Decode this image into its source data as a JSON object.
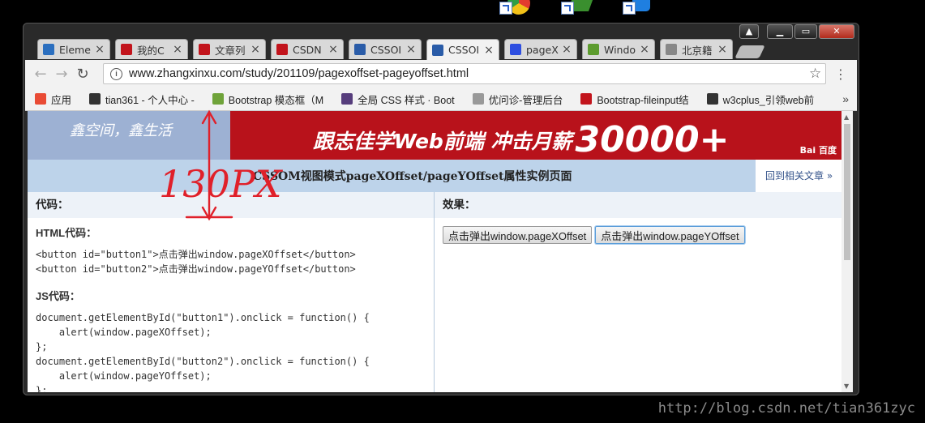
{
  "window": {
    "tabs": [
      {
        "label": "Eleme",
        "icon": "element-icon",
        "color": "#2b6fbf"
      },
      {
        "label": "我的C",
        "icon": "csdn-icon",
        "color": "#c2141c"
      },
      {
        "label": "文章列",
        "icon": "csdn-icon",
        "color": "#c2141c"
      },
      {
        "label": "CSDN",
        "icon": "csdn-icon",
        "color": "#c2141c"
      },
      {
        "label": "CSSOI",
        "icon": "grid-icon",
        "color": "#2a5ca8"
      },
      {
        "label": "CSSOI",
        "icon": "grid-icon",
        "color": "#2a5ca8"
      },
      {
        "label": "pageX",
        "icon": "paw-icon",
        "color": "#2d4ee0"
      },
      {
        "label": "Windo",
        "icon": "eye-icon",
        "color": "#5d9c2f"
      },
      {
        "label": "北京籍",
        "icon": "page-icon",
        "color": "#888888"
      }
    ],
    "active_tab": 5,
    "close_glyph": "×"
  },
  "toolbar": {
    "back": "←",
    "forward": "→",
    "reload": "↻",
    "url": "www.zhangxinxu.com/study/201109/pagexoffset-pageyoffset.html",
    "star": "☆",
    "menu": "⋮",
    "info": "i"
  },
  "bookmarks": {
    "items": [
      {
        "label": "应用",
        "icon": "apps-icon"
      },
      {
        "label": "tian361 - 个人中心 -",
        "icon": "user-icon"
      },
      {
        "label": "Bootstrap 模态框（M",
        "icon": "bootstrap-icon"
      },
      {
        "label": "全局 CSS 样式 · Boot",
        "icon": "b-icon"
      },
      {
        "label": "优问诊-管理后台",
        "icon": "page-icon"
      },
      {
        "label": "Bootstrap-fileinput结",
        "icon": "csdn-icon"
      },
      {
        "label": "w3cplus_引领web前",
        "icon": "w3c-icon"
      }
    ],
    "more": "»"
  },
  "page": {
    "banner_left": "鑫空间，鑫生活",
    "banner_ad": "跟志佳学Web前端  冲击月薪",
    "banner_ad_big": "30000+",
    "baidu": "Bai 百度",
    "title": "CSSOM视图模式pageXOffset/pageYOffset属性实例页面",
    "back_link": "回到相关文章 »",
    "code_header": "代码：",
    "effect_header": "效果：",
    "html_label": "HTML代码：",
    "js_label": "JS代码：",
    "button1": "点击弹出window.pageXOffset",
    "button2": "点击弹出window.pageYOffset",
    "html_lines": [
      "<button id=\"button1\">点击弹出window.pageXOffset</button>",
      "<button id=\"button2\">点击弹出window.pageYOffset</button>"
    ],
    "js_lines": [
      "document.getElementById(\"button1\").onclick = function() {",
      "    alert(window.pageXOffset);",
      "};",
      "document.getElementById(\"button2\").onclick = function() {",
      "    alert(window.pageYOffset);",
      "};"
    ]
  },
  "annotation": {
    "text": "130PX",
    "color": "#e0202a"
  },
  "watermark": "http://blog.csdn.net/tian361zyc"
}
